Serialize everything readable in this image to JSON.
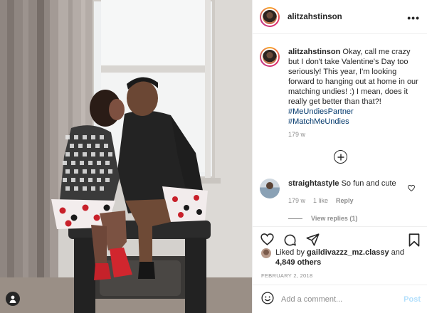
{
  "post": {
    "author": "alitzahstinson",
    "caption": "Okay, call me crazy but I don't take Valentine's Day too seriously! This year, I'm looking forward to hanging out at home in our matching undies! :) I mean, does it really get better than that?!",
    "hashtags": [
      "#MeUndiesPartner",
      "#MatchMeUndies"
    ],
    "caption_time": "179 w",
    "date": "FEBRUARY 2, 2018"
  },
  "comments": [
    {
      "user": "straightastyle",
      "text": "So fun and cute",
      "time": "179 w",
      "likes": "1 like",
      "reply_label": "Reply",
      "view_replies": "View replies (1)"
    }
  ],
  "likes": {
    "prefix": "Liked by",
    "user": "gaildivazzz_mz.classy",
    "connector": "and",
    "others": "4,849 others"
  },
  "comment_box": {
    "placeholder": "Add a comment...",
    "post_label": "Post"
  },
  "icons": {
    "more": "more-options-icon",
    "load_more": "plus-circle-icon",
    "like": "heart-icon",
    "comment": "comment-icon",
    "share": "share-icon",
    "save": "bookmark-icon",
    "emoji": "emoji-icon",
    "tagged": "user-tag-icon"
  },
  "colors": {
    "link": "#00376b",
    "muted": "#8e8e8e",
    "post_disabled": "#b2dffc",
    "border": "#efefef"
  }
}
